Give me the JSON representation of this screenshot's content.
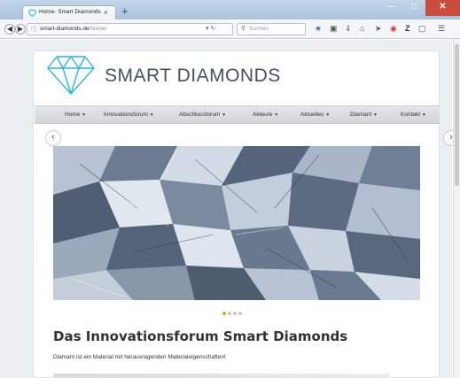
{
  "browser": {
    "tab_title": "Home- Smart Diamonds",
    "tab_close": "×",
    "new_tab": "+",
    "url_domain": "smart-diamonds.de",
    "url_path": "/home/",
    "search_placeholder": "Suchen",
    "icons": [
      "bookmark-star-icon",
      "reading-list-icon",
      "download-icon",
      "home-icon",
      "send-icon",
      "pocket-icon",
      "zotero-icon",
      "hamburger-menu-icon"
    ]
  },
  "site": {
    "logo_text": "SMART DIAMONDS",
    "brand_color": "#2fb6d8",
    "menu": [
      {
        "label": "Home"
      },
      {
        "label": "Innovationsforum"
      },
      {
        "label": "Abschlussforum"
      },
      {
        "label": "Akteure"
      },
      {
        "label": "Aktuelles"
      },
      {
        "label": "Diamant"
      },
      {
        "label": "Kontakt"
      }
    ],
    "slider": {
      "slide_count": 4,
      "active_slide": 1
    },
    "heading": "Das Innovationsforum Smart Diamonds",
    "intro": "Diamant ist ein Material mit herausragenden Materialeigenschaften!"
  }
}
